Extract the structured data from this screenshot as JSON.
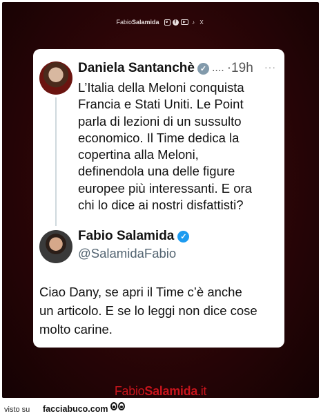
{
  "header": {
    "brand_light": "Fabio",
    "brand_bold": "Salamida",
    "social_icons": [
      "instagram-icon",
      "facebook-icon",
      "youtube-icon",
      "tiktok-icon",
      "x-icon"
    ],
    "icon_glyphs": {
      "facebook": "f",
      "youtube": "▶",
      "tiktok": "♪",
      "x": "X"
    }
  },
  "tweet_1": {
    "author": "Daniela Santanchè",
    "verified_color": "#829aab",
    "ellipsis": "....",
    "time": "·19h",
    "more": "···",
    "lines": [
      "L’Italia della Meloni conquista",
      "Francia e Stati Uniti. Le Point",
      "parla di lezioni di un sussulto",
      "economico. Il Time dedica la",
      "copertina alla Meloni,",
      "definendola una delle figure",
      "europee più interessanti. E ora",
      "chi lo dice ai nostri disfattisti?"
    ]
  },
  "tweet_2": {
    "author": "Fabio Salamida",
    "handle": "@SalamidaFabio",
    "verified_color": "#1d9bf0",
    "lines": [
      "Ciao Dany, se apri il Time c’è anche",
      "un articolo. E se lo leggi non dice cose",
      "molto carine."
    ]
  },
  "watermark": {
    "light": "Fabio",
    "bold": "Salamida",
    "suffix": ".it",
    "color": "#c8141c"
  },
  "footer": {
    "visto_su": "visto su",
    "site": "facciabuco.com"
  }
}
